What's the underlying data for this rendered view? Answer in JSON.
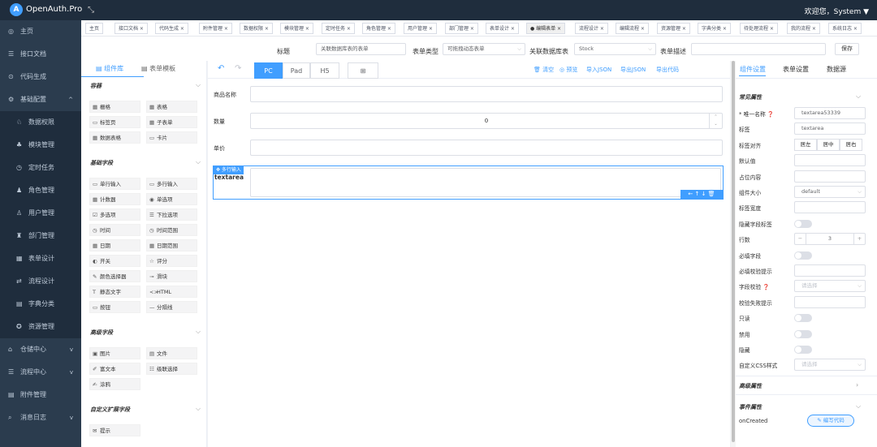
{
  "app": {
    "logo": "A",
    "title": "OpenAuth.Pro",
    "welcome": "欢迎您，System ▼"
  },
  "sidebar": [
    {
      "label": "主页",
      "icon": "◎",
      "sub": false,
      "arrow": ""
    },
    {
      "label": "接口文档",
      "icon": "☰",
      "sub": false,
      "arrow": ""
    },
    {
      "label": "代码生成",
      "icon": "⊙",
      "sub": false,
      "arrow": ""
    },
    {
      "label": "基础配置",
      "icon": "⚙",
      "sub": false,
      "arrow": "^"
    },
    {
      "label": "数据权限",
      "icon": "♘",
      "sub": true,
      "arrow": ""
    },
    {
      "label": "模块管理",
      "icon": "♣",
      "sub": true,
      "arrow": ""
    },
    {
      "label": "定时任务",
      "icon": "◷",
      "sub": true,
      "arrow": ""
    },
    {
      "label": "角色管理",
      "icon": "♟",
      "sub": true,
      "arrow": ""
    },
    {
      "label": "用户管理",
      "icon": "♙",
      "sub": true,
      "arrow": ""
    },
    {
      "label": "部门管理",
      "icon": "♜",
      "sub": true,
      "arrow": ""
    },
    {
      "label": "表单设计",
      "icon": "▦",
      "sub": true,
      "arrow": ""
    },
    {
      "label": "流程设计",
      "icon": "⇄",
      "sub": true,
      "arrow": ""
    },
    {
      "label": "字典分类",
      "icon": "▤",
      "sub": true,
      "arrow": ""
    },
    {
      "label": "资源管理",
      "icon": "✪",
      "sub": true,
      "arrow": ""
    },
    {
      "label": "仓储中心",
      "icon": "⌂",
      "sub": false,
      "arrow": "v"
    },
    {
      "label": "流程中心",
      "icon": "☰",
      "sub": false,
      "arrow": "v"
    },
    {
      "label": "附件管理",
      "icon": "▤",
      "sub": false,
      "arrow": ""
    },
    {
      "label": "消息日志",
      "icon": "⌕",
      "sub": false,
      "arrow": "v"
    }
  ],
  "tabs": [
    {
      "label": "主页"
    },
    {
      "label": "接口文档 ×"
    },
    {
      "label": "代码生成 ×"
    },
    {
      "label": "附件管理 ×"
    },
    {
      "label": "数据权限 ×"
    },
    {
      "label": "模块管理 ×"
    },
    {
      "label": "定时任务 ×"
    },
    {
      "label": "角色管理 ×"
    },
    {
      "label": "用户管理 ×"
    },
    {
      "label": "部门管理 ×"
    },
    {
      "label": "表单设计 ×"
    },
    {
      "label": "● 编辑表单 ×",
      "active": true
    },
    {
      "label": "流程设计 ×"
    },
    {
      "label": "编辑流程 ×"
    },
    {
      "label": "资源管理 ×"
    },
    {
      "label": "字典分类 ×"
    },
    {
      "label": "待处理流程 ×"
    },
    {
      "label": "我的流程 ×"
    },
    {
      "label": "系统日志 ×"
    }
  ],
  "header": {
    "title_label": "标题",
    "title_value": "关联数据库表的表单",
    "type_label": "表单类型",
    "type_value": "可拖拽动态表单",
    "db_label": "关联数据库表",
    "db_value": "Stock",
    "desc_label": "表单描述",
    "desc_value": "",
    "save": "保存"
  },
  "palette": {
    "tab_components": "▤ 组件库",
    "tab_templates": "▤ 表单模板",
    "sections": [
      {
        "title": "容器",
        "items": [
          {
            "icon": "▦",
            "label": "栅格"
          },
          {
            "icon": "▦",
            "label": "表格"
          },
          {
            "icon": "▭",
            "label": "标签页"
          },
          {
            "icon": "▦",
            "label": "子表单"
          },
          {
            "icon": "▦",
            "label": "数据表格"
          },
          {
            "icon": "▭",
            "label": "卡片"
          }
        ]
      },
      {
        "title": "基础字段",
        "items": [
          {
            "icon": "▭",
            "label": "单行输入"
          },
          {
            "icon": "▭",
            "label": "多行输入"
          },
          {
            "icon": "▦",
            "label": "计数器"
          },
          {
            "icon": "◉",
            "label": "单选项"
          },
          {
            "icon": "☑",
            "label": "多选项"
          },
          {
            "icon": "☰",
            "label": "下拉选项"
          },
          {
            "icon": "◷",
            "label": "时间"
          },
          {
            "icon": "◷",
            "label": "时间范围"
          },
          {
            "icon": "▦",
            "label": "日期"
          },
          {
            "icon": "▦",
            "label": "日期范围"
          },
          {
            "icon": "◐",
            "label": "开关"
          },
          {
            "icon": "☆",
            "label": "评分"
          },
          {
            "icon": "✎",
            "label": "颜色选择器"
          },
          {
            "icon": "⊸",
            "label": "滑块"
          },
          {
            "icon": "T",
            "label": "静态文字"
          },
          {
            "icon": "<>",
            "label": "HTML"
          },
          {
            "icon": "▭",
            "label": "按钮"
          },
          {
            "icon": "—",
            "label": "分隔线"
          }
        ]
      },
      {
        "title": "高级字段",
        "items": [
          {
            "icon": "▣",
            "label": "图片"
          },
          {
            "icon": "▤",
            "label": "文件"
          },
          {
            "icon": "✐",
            "label": "富文本"
          },
          {
            "icon": "☷",
            "label": "级联选择"
          },
          {
            "icon": "✍",
            "label": "涂鸦"
          }
        ]
      },
      {
        "title": "自定义扩展字段",
        "items": [
          {
            "icon": "✉",
            "label": "提示"
          }
        ]
      }
    ]
  },
  "toolbar": {
    "undo": "↶",
    "redo": "↷",
    "devices": [
      "PC",
      "Pad",
      "H5"
    ],
    "layout": "⊞",
    "actions": [
      "🗑 清空",
      "◎ 预览",
      "导入JSON",
      "导出JSON",
      "导出代码"
    ]
  },
  "canvas": {
    "fields": [
      {
        "label": "商品名称",
        "value": ""
      },
      {
        "label": "数量",
        "value": "0"
      },
      {
        "label": "单价",
        "value": ""
      }
    ],
    "selected": {
      "label": "textarea",
      "badge": "✥ 多行输入",
      "tools": "←  ↑  ↓  🗑"
    }
  },
  "right": {
    "tabs": [
      "组件设置",
      "表单设置",
      "数据源"
    ],
    "common_title": "常见属性",
    "props": [
      {
        "label": "* 唯一名称 ❓",
        "type": "input",
        "value": "textarea53339"
      },
      {
        "label": "标签",
        "type": "input",
        "value": "textarea"
      },
      {
        "label": "标签对齐",
        "type": "align",
        "options": [
          "居左",
          "居中",
          "居右"
        ]
      },
      {
        "label": "默认值",
        "type": "input",
        "value": ""
      },
      {
        "label": "占位内容",
        "type": "input",
        "value": ""
      },
      {
        "label": "组件大小",
        "type": "select",
        "value": "default"
      },
      {
        "label": "标签宽度",
        "type": "input",
        "value": ""
      },
      {
        "label": "隐藏字段标签",
        "type": "toggle"
      },
      {
        "label": "行数",
        "type": "stepper",
        "value": "3"
      },
      {
        "label": "必填字段",
        "type": "toggle"
      },
      {
        "label": "必填校验提示",
        "type": "input",
        "value": ""
      },
      {
        "label": "字段校验 ❓",
        "type": "select",
        "value": "请选择",
        "ph": true
      },
      {
        "label": "校验失败提示",
        "type": "input",
        "value": ""
      },
      {
        "label": "只读",
        "type": "toggle"
      },
      {
        "label": "禁用",
        "type": "toggle"
      },
      {
        "label": "隐藏",
        "type": "toggle"
      },
      {
        "label": "自定义CSS样式",
        "type": "select",
        "value": "请选择",
        "ph": true
      }
    ],
    "advanced_title": "高级属性",
    "event_title": "事件属性",
    "event_name": "onCreated",
    "event_btn": "✎ 编写代码"
  }
}
